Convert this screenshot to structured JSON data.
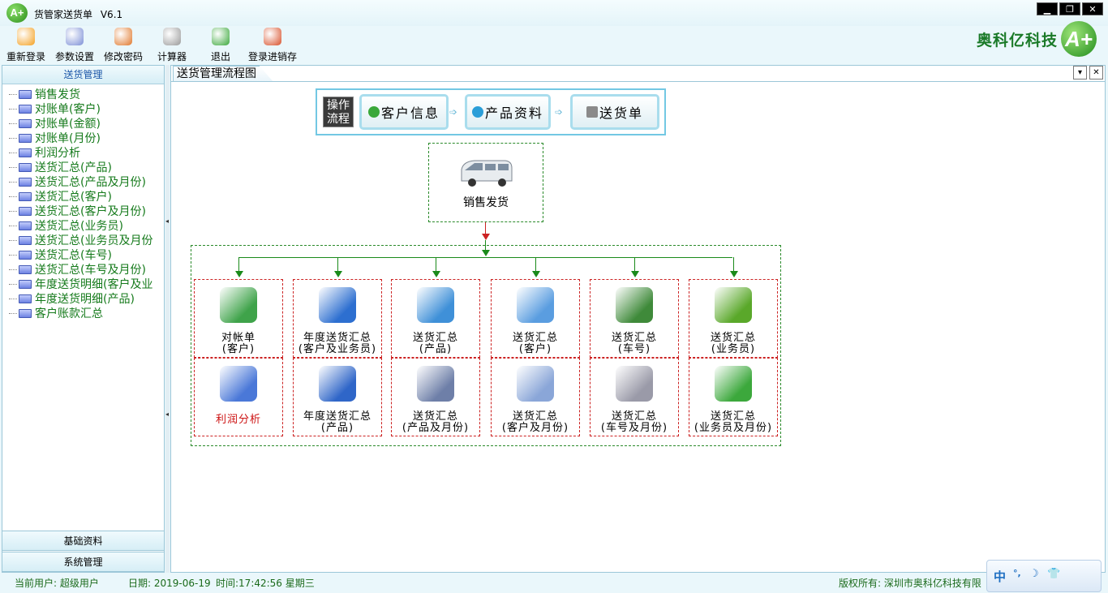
{
  "window": {
    "app_icon_text": "A+",
    "title": "货管家送货单",
    "version": "V6.1",
    "controls": [
      "▁",
      "❐",
      "✕"
    ]
  },
  "toolbar": [
    {
      "label": "重新登录",
      "icon": "user-login-icon",
      "color": "#f4a020"
    },
    {
      "label": "参数设置",
      "icon": "gear-settings-icon",
      "color": "#7c8fd6"
    },
    {
      "label": "修改密码",
      "icon": "pencil-key-icon",
      "color": "#e0772a"
    },
    {
      "label": "计算器",
      "icon": "calculator-icon",
      "color": "#9a9a9a"
    },
    {
      "label": "退出",
      "icon": "exit-house-icon",
      "color": "#3aa83a"
    },
    {
      "label": "登录进销存",
      "icon": "inventory-login-icon",
      "color": "#d8502a"
    }
  ],
  "brand": {
    "name": "奥科亿科技",
    "logo_text": "A+"
  },
  "sidebar": {
    "section_title": "送货管理",
    "items": [
      "销售发货",
      "对账单(客户)",
      "对账单(金额)",
      "对账单(月份)",
      "利润分析",
      "送货汇总(产品)",
      "送货汇总(产品及月份)",
      "送货汇总(客户)",
      "送货汇总(客户及月份)",
      "送货汇总(业务员)",
      "送货汇总(业务员及月份",
      "送货汇总(车号)",
      "送货汇总(车号及月份)",
      "年度送货明细(客户及业",
      "年度送货明细(产品)",
      "客户账款汇总"
    ],
    "scroll_left": "‹",
    "scroll_right": "›",
    "other_sections": [
      "基础资料",
      "系统管理"
    ]
  },
  "document": {
    "tab_title": "送货管理流程图",
    "tab_buttons": [
      "▾",
      "✕"
    ],
    "flow": {
      "badge": [
        "操作",
        "流程"
      ],
      "steps": [
        "客户信息",
        "产品资料",
        "送货单"
      ],
      "arrow": "➩"
    },
    "dispatch_label": "销售发货",
    "cells": [
      {
        "l1": "对帐单",
        "l2": "(客户)",
        "icon": "ledger-book-icon",
        "color": "#3fa34a"
      },
      {
        "l1": "年度送货汇总",
        "l2": "(客户及业务员)",
        "icon": "pen-document-icon",
        "color": "#2d6fd0"
      },
      {
        "l1": "送货汇总",
        "l2": "(产品)",
        "icon": "globe-folder-icon",
        "color": "#3f90d8"
      },
      {
        "l1": "送货汇总",
        "l2": "(客户)",
        "icon": "customer-monitor-icon",
        "color": "#5a9de0"
      },
      {
        "l1": "送货汇总",
        "l2": "(车号)",
        "icon": "tools-document-icon",
        "color": "#3f8a3a"
      },
      {
        "l1": "送货汇总",
        "l2": "(业务员)",
        "icon": "green-folder-icon",
        "color": "#5aa82a"
      },
      {
        "l1": "利润分析",
        "l2": "",
        "icon": "profit-disc-icon",
        "color": "#4a78d8",
        "red": true
      },
      {
        "l1": "年度送货汇总",
        "l2": "(产品)",
        "icon": "globe-book-icon",
        "color": "#2f66c8"
      },
      {
        "l1": "送货汇总",
        "l2": "(产品及月份)",
        "icon": "screen-monitor-icon",
        "color": "#6e7fa8"
      },
      {
        "l1": "送货汇总",
        "l2": "(客户及月份)",
        "icon": "chart-document-icon",
        "color": "#8aa6d8"
      },
      {
        "l1": "送货汇总",
        "l2": "(车号及月份)",
        "icon": "ruler-document-icon",
        "color": "#9a9aa8"
      },
      {
        "l1": "送货汇总",
        "l2": "(业务员及月份)",
        "icon": "shapes-icon",
        "color": "#3ca83c"
      }
    ]
  },
  "status": {
    "user": "当前用户: 超级用户",
    "date": "日期: 2019-06-19",
    "time": "时间:17:42:56 星期三",
    "copyright": "版权所有: 深圳市奥科亿科技有限"
  },
  "ime": [
    "中",
    "°,",
    "☽",
    "👕"
  ]
}
